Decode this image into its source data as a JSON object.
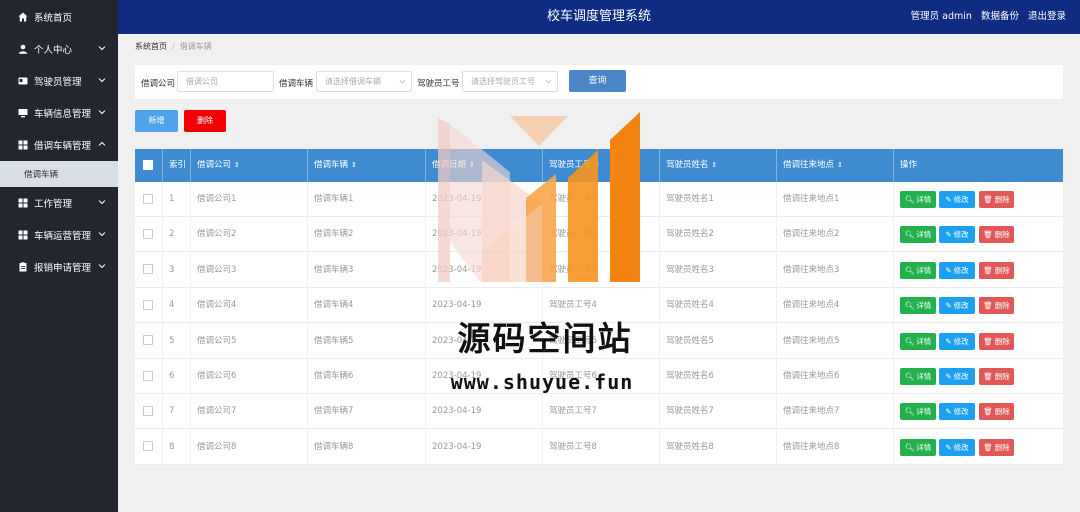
{
  "app": {
    "title": "校车调度管理系统"
  },
  "header": {
    "user_prefix": "管理员",
    "username": "admin",
    "backup": "数据备份",
    "logout": "退出登录"
  },
  "sidebar": {
    "items": [
      {
        "label": "系统首页",
        "icon": "home-icon"
      },
      {
        "label": "个人中心",
        "icon": "user-icon"
      },
      {
        "label": "驾驶员管理",
        "icon": "card-icon"
      },
      {
        "label": "车辆信息管理",
        "icon": "monitor-icon"
      },
      {
        "label": "借调车辆管理",
        "icon": "grid-icon"
      },
      {
        "label": "借调车辆",
        "icon": ""
      },
      {
        "label": "工作管理",
        "icon": "grid-icon"
      },
      {
        "label": "车辆运营管理",
        "icon": "grid-icon"
      },
      {
        "label": "报销申请管理",
        "icon": "clipboard-icon"
      }
    ]
  },
  "breadcrumb": {
    "home": "系统首页",
    "current": "借调车辆"
  },
  "search": {
    "company_label": "借调公司",
    "company_placeholder": "借调公司",
    "vehicle_label": "借调车辆",
    "vehicle_placeholder": "请选择借调车辆",
    "driver_label": "驾驶员工号",
    "driver_placeholder": "请选择驾驶员工号",
    "query_button": "查询"
  },
  "actions": {
    "add": "新增",
    "delete": "删除"
  },
  "table": {
    "headers": [
      "索引",
      "借调公司",
      "借调车辆",
      "借调日期",
      "驾驶员工号",
      "驾驶员姓名",
      "借调往来地点",
      "操作"
    ],
    "sort_icon": "⇕",
    "buttons": {
      "detail": "详情",
      "edit": "修改",
      "delete": "删除"
    },
    "rows": [
      [
        "1",
        "借调公司1",
        "借调车辆1",
        "2023-04-19",
        "驾驶员工号1",
        "驾驶员姓名1",
        "借调往来地点1"
      ],
      [
        "2",
        "借调公司2",
        "借调车辆2",
        "2023-04-19",
        "驾驶员工号2",
        "驾驶员姓名2",
        "借调往来地点2"
      ],
      [
        "3",
        "借调公司3",
        "借调车辆3",
        "2023-04-19",
        "驾驶员工号3",
        "驾驶员姓名3",
        "借调往来地点3"
      ],
      [
        "4",
        "借调公司4",
        "借调车辆4",
        "2023-04-19",
        "驾驶员工号4",
        "驾驶员姓名4",
        "借调往来地点4"
      ],
      [
        "5",
        "借调公司5",
        "借调车辆5",
        "2023-04-19",
        "驾驶员工号5",
        "驾驶员姓名5",
        "借调往来地点5"
      ],
      [
        "6",
        "借调公司6",
        "借调车辆6",
        "2023-04-19",
        "驾驶员工号6",
        "驾驶员姓名6",
        "借调往来地点6"
      ],
      [
        "7",
        "借调公司7",
        "借调车辆7",
        "2023-04-19",
        "驾驶员工号7",
        "驾驶员姓名7",
        "借调往来地点7"
      ],
      [
        "8",
        "借调公司8",
        "借调车辆8",
        "2023-04-19",
        "驾驶员工号8",
        "驾驶员姓名8",
        "借调往来地点8"
      ]
    ]
  },
  "watermark": {
    "text": "源码空间站",
    "url": "www.shuyue.fun"
  },
  "colors": {
    "sidebar": "#23262e",
    "header": "#0d2c82",
    "table_header": "#3e8bd2",
    "detail": "#22b14c",
    "edit": "#1ea0f0",
    "delete": "#e05858",
    "danger": "#f00000"
  }
}
